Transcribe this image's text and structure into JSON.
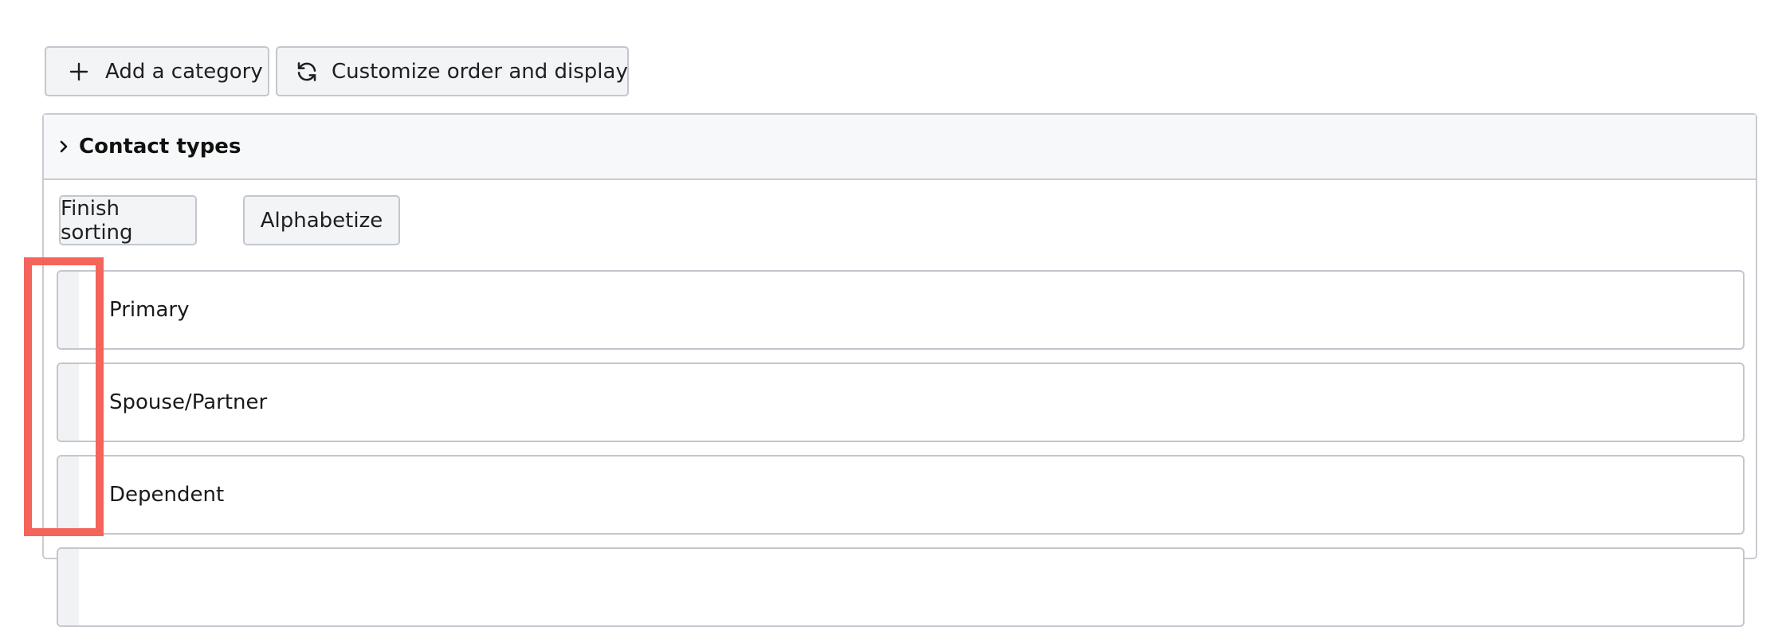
{
  "toolbar": {
    "add_label": "Add a category",
    "add_icon": "plus-icon",
    "customize_label": "Customize order and display",
    "customize_icon": "refresh-icon"
  },
  "section": {
    "title": "Contact types",
    "toggle_icon": "chevron-right-icon",
    "finish_label": "Finish sorting",
    "alphabetize_label": "Alphabetize",
    "items": [
      {
        "label": "Primary"
      },
      {
        "label": "Spouse/Partner"
      },
      {
        "label": "Dependent"
      },
      {
        "label": ""
      }
    ]
  },
  "colors": {
    "highlight": "#f4645a",
    "button_bg": "#f3f4f6",
    "border": "#c3c7cd",
    "header_bg": "#f7f8f9",
    "handle_bg": "#f1f2f4"
  }
}
